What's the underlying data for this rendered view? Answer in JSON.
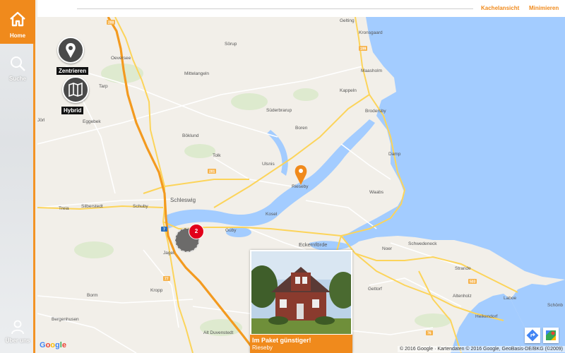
{
  "sidebar": {
    "home_label": "Home",
    "search_label": "Suche",
    "about_label": "Über uns"
  },
  "topbar": {
    "tile_view": "Kachelansicht",
    "minimize": "Minimieren"
  },
  "map_controls": {
    "center_label": "Zentrieren",
    "hybrid_label": "Hybrid"
  },
  "cluster": {
    "count": "2"
  },
  "popup": {
    "title": "Im Paket günstiger!",
    "location": "Rieseby"
  },
  "map_labels": {
    "towns": [
      "Gelting",
      "Kronsgaard",
      "Oeversee",
      "Sörup",
      "Tarp",
      "Mittelangeln",
      "Maasholm",
      "Kappeln",
      "Eggebek",
      "Süderbrarup",
      "Brodersby",
      "Jörl",
      "Böklund",
      "Boren",
      "Tolk",
      "Damp",
      "Ulsnis",
      "Rieseby",
      "Waabs",
      "Schleswig",
      "Treia",
      "Silberstedt",
      "Schuby",
      "Kosel",
      "Güby",
      "Jagel",
      "Eckernförde",
      "Noer",
      "Schwedeneck",
      "Strande",
      "Gettorf",
      "Borm",
      "Kropp",
      "Altenholz",
      "Laboe",
      "Schönb",
      "Heikendorf",
      "Bergenhusen",
      "Alt Duvenstedt"
    ],
    "road_numbers": [
      "200",
      "199",
      "201",
      "7",
      "77",
      "503",
      "76"
    ]
  },
  "google_logo": "Google",
  "attribution": "© 2016 Google · Kartendaten © 2016 Google, GeoBasis-DE/BKG (©2009)",
  "colors": {
    "accent": "#f08a1c",
    "sea": "#a3ccff",
    "land": "#f2efe9",
    "cluster_badge": "#e2001a"
  },
  "icons": [
    "home-icon",
    "search-icon",
    "user-icon",
    "location-pin-icon",
    "map-icon",
    "directions-icon",
    "google-maps-icon"
  ]
}
